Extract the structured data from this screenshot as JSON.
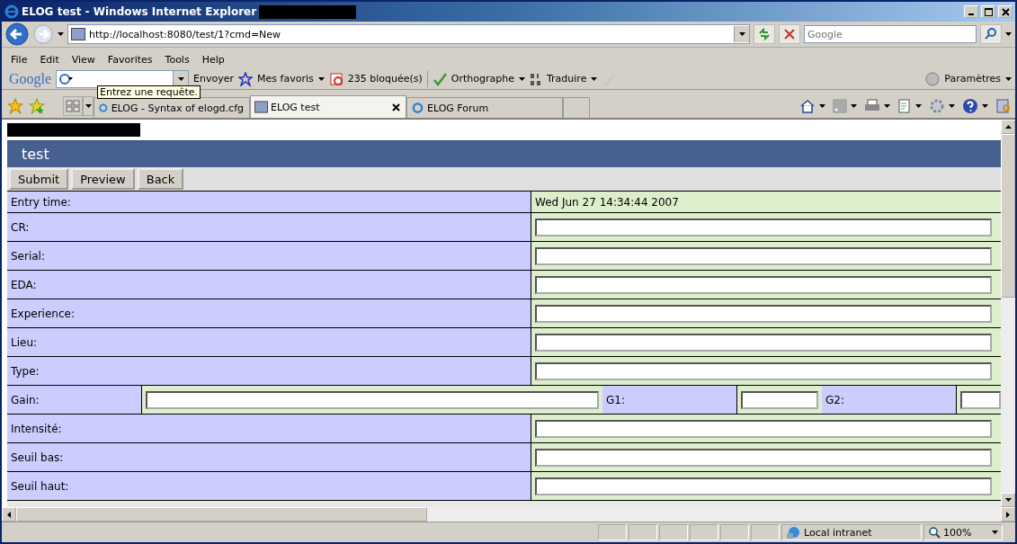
{
  "window": {
    "title": "ELOG test - Windows Internet Explorer"
  },
  "address_bar": {
    "url": "http://localhost:8080/test/1?cmd=New",
    "search_placeholder": "Google"
  },
  "menu": [
    "File",
    "Edit",
    "View",
    "Favorites",
    "Tools",
    "Help"
  ],
  "google_toolbar": {
    "logo": "Google",
    "send": "Envoyer",
    "favorites": "Mes favoris",
    "blocked": "235 bloquée(s)",
    "spelling": "Orthographe",
    "translate": "Traduire",
    "settings": "Paramètres",
    "tooltip": "Entrez une requête."
  },
  "tabs": [
    {
      "label": "ELOG - Syntax of elogd.cfg",
      "selected": false
    },
    {
      "label": "ELOG test",
      "selected": true
    },
    {
      "label": "ELOG Forum",
      "selected": false
    }
  ],
  "page": {
    "logbook_title": "test",
    "buttons": [
      "Submit",
      "Preview",
      "Back"
    ],
    "fields": [
      {
        "kind": "static",
        "label": "Entry time:",
        "value": "Wed Jun 27 14:34:44 2007"
      },
      {
        "kind": "input",
        "label": "CR:"
      },
      {
        "kind": "input",
        "label": "Serial:"
      },
      {
        "kind": "input",
        "label": "EDA:"
      },
      {
        "kind": "input",
        "label": "Experience:"
      },
      {
        "kind": "input",
        "label": "Lieu:"
      },
      {
        "kind": "input",
        "label": "Type:"
      },
      {
        "kind": "multi",
        "parts": [
          "Gain:",
          "G1:",
          "G2:"
        ]
      },
      {
        "kind": "input",
        "label": "Intensité:"
      },
      {
        "kind": "input",
        "label": "Seuil bas:"
      },
      {
        "kind": "input",
        "label": "Seuil haut:"
      }
    ]
  },
  "status_bar": {
    "zone": "Local intranet",
    "zoom": "100%"
  }
}
